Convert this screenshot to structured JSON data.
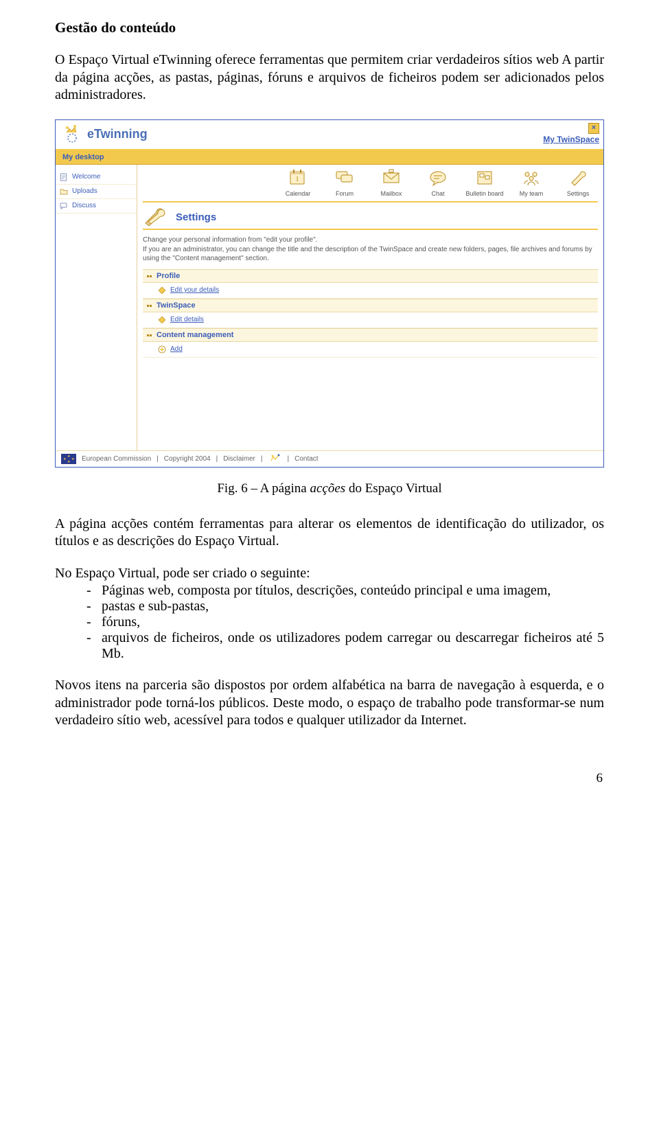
{
  "heading": "Gestão do conteúdo",
  "intro": "O Espaço Virtual eTwinning oferece ferramentas que permitem criar verdadeiros sítios web A partir da página acções, as pastas, páginas, fóruns e arquivos de ficheiros podem ser adicionados pelos administradores.",
  "figure": {
    "logo_text": "eTwinning",
    "my_twinspace": "My TwinSpace",
    "my_desktop": "My desktop",
    "close": "×",
    "sidebar": {
      "items": [
        {
          "label": "Welcome"
        },
        {
          "label": "Uploads"
        },
        {
          "label": "Discuss"
        }
      ]
    },
    "top_icons": [
      {
        "label": "Calendar"
      },
      {
        "label": "Forum"
      },
      {
        "label": "Mailbox"
      },
      {
        "label": "Chat"
      },
      {
        "label": "Bulletin board"
      },
      {
        "label": "My team"
      },
      {
        "label": "Settings"
      }
    ],
    "settings_title": "Settings",
    "settings_blurb_1": "Change your personal information from \"edit your profile\".",
    "settings_blurb_2": "If you are an administrator, you can change the title and the description of the TwinSpace and create new folders, pages, file archives and forums by using the \"Content management\" section.",
    "sections": {
      "profile": {
        "title": "Profile",
        "link": "Edit your details"
      },
      "twinspace": {
        "title": "TwinSpace",
        "link": "Edit details"
      },
      "content_mgmt": {
        "title": "Content management",
        "link": "Add"
      }
    },
    "footer": {
      "ec": "European Commission",
      "copyright": "Copyright 2004",
      "disclaimer": "Disclaimer",
      "contact": "Contact"
    }
  },
  "caption_prefix": "Fig. 6 – A página ",
  "caption_italic": "acções",
  "caption_suffix": " do Espaço Virtual",
  "para_after_fig": "A página acções contém ferramentas para alterar os elementos de identificação do utilizador, os títulos e as descrições do Espaço Virtual.",
  "list_lead": "No Espaço Virtual, pode ser criado o seguinte:",
  "list_items": [
    "Páginas web, composta por títulos, descrições, conteúdo principal e uma imagem,",
    "pastas e sub-pastas,",
    "fóruns,",
    "arquivos de ficheiros, onde os utilizadores podem carregar ou descarregar ficheiros até 5 Mb."
  ],
  "closing": "Novos itens na parceria são dispostos por ordem alfabética na barra de navegação à esquerda, e o administrador pode torná-los públicos. Deste modo, o espaço de trabalho pode transformar-se num verdadeiro sítio web, acessível para todos e qualquer utilizador da Internet.",
  "page_number": "6"
}
